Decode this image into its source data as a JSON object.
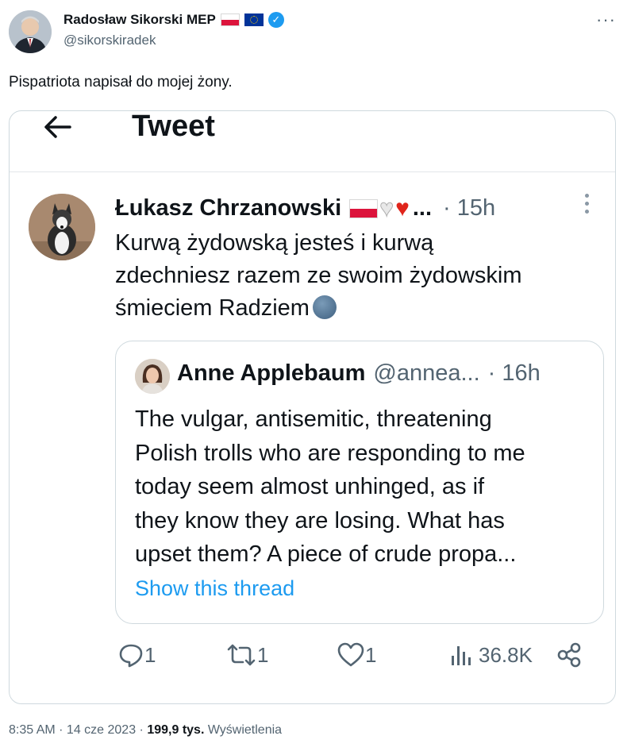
{
  "outer_tweet": {
    "author_name": "Radosław Sikorski MEP",
    "author_handle": "@sikorskiradek",
    "verified_icon": "verified-badge-icon",
    "more_icon": "more-horizontal-icon",
    "text": "Pispatriota napisał do mojej żony."
  },
  "screenshot": {
    "page_title": "Tweet",
    "back_icon": "arrow-left-icon",
    "tweet": {
      "author_name": "Łukasz Chrzanowski",
      "name_ellipsis": "...",
      "time": "· 15h",
      "lines": [
        "Kurwą żydowską jesteś i kurwą",
        "zdechniesz razem ze swoim żydowskim",
        "śmieciem Radziem"
      ]
    },
    "quote": {
      "author_name": "Anne Applebaum",
      "author_handle": "@annea...",
      "time": "· 16h",
      "lines": [
        "The vulgar, antisemitic, threatening",
        "Polish trolls who are responding to me",
        "today seem almost unhinged, as if",
        "they know they are losing. What has",
        "upset them? A piece of crude propa..."
      ],
      "show_thread": "Show this thread"
    },
    "actions": {
      "reply_count": "1",
      "retweet_count": "1",
      "like_count": "1",
      "views_count": "36.8K"
    }
  },
  "footer": {
    "time_date": "8:35 AM · 14 cze 2023 · ",
    "views_value": "199,9 tys.",
    "views_label": " Wyświetlenia"
  },
  "colors": {
    "accent": "#1d9bf0",
    "secondary_text": "#536471",
    "border": "#cfd9de"
  }
}
